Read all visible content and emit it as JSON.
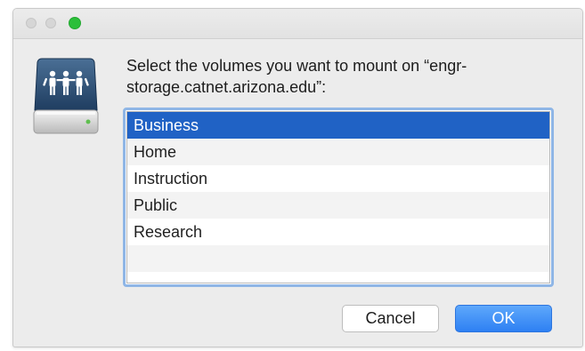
{
  "window": {
    "controls": [
      "close",
      "minimize",
      "zoom"
    ]
  },
  "dialog": {
    "icon": "network-server-icon",
    "prompt": "Select the volumes you want to mount on “engr-storage.catnet.arizona.edu”:",
    "volumes": [
      {
        "label": "Business",
        "selected": true
      },
      {
        "label": "Home",
        "selected": false
      },
      {
        "label": "Instruction",
        "selected": false
      },
      {
        "label": "Public",
        "selected": false
      },
      {
        "label": "Research",
        "selected": false
      }
    ],
    "buttons": {
      "cancel": "Cancel",
      "ok": "OK"
    }
  },
  "colors": {
    "selection": "#2062c5",
    "ok_button": "#3a8cf6",
    "zoom_button": "#2bbf3a",
    "focus_ring": "#8fb6e6"
  }
}
